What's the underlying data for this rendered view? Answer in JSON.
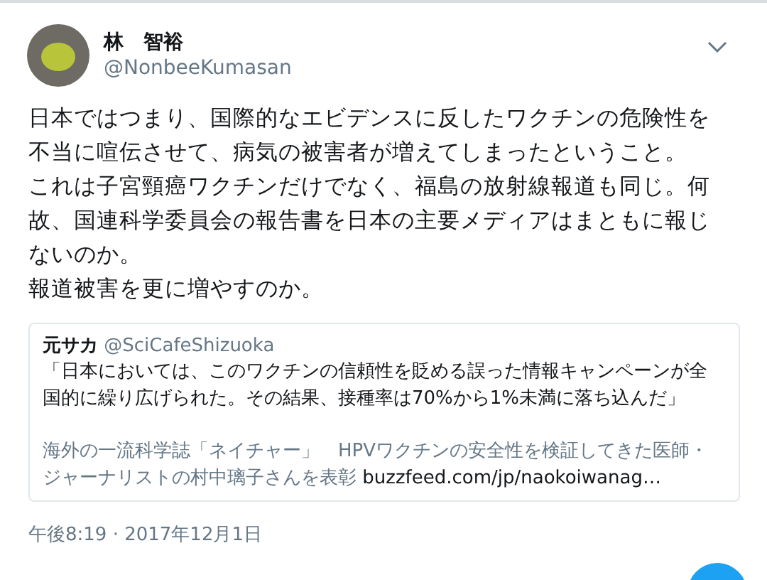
{
  "tweet": {
    "author": {
      "name": "林　智裕",
      "handle": "@NonbeeKumasan"
    },
    "paragraphs": [
      "日本ではつまり、国際的なエビデンスに反したワクチンの危険性を不当に喧伝させて、病気の被害者が増えてしまったということ。",
      "これは子宮頸癌ワクチンだけでなく、福島の放射線報道も同じ。何故、国連科学委員会の報告書を日本の主要メディアはまともに報じないのか。",
      "報道被害を更に増やすのか。"
    ],
    "quoted": {
      "name": "元サカ",
      "handle": "@SciCafeShizuoka",
      "text": "「日本においては、このワクチンの信頼性を貶める誤った情報キャンペーンが全国的に繰り広げられた。その結果、接種率は70%から1%未満に落ち込んだ」",
      "note": "海外の一流科学誌「ネイチャー」　HPVワクチンの安全性を検証してきた医師・ジャーナリストの村中璃子さんを表彰",
      "link": "buzzfeed.com/jp/naokoiwanag…"
    },
    "timestamp": "午後8:19 · 2017年12月1日"
  }
}
